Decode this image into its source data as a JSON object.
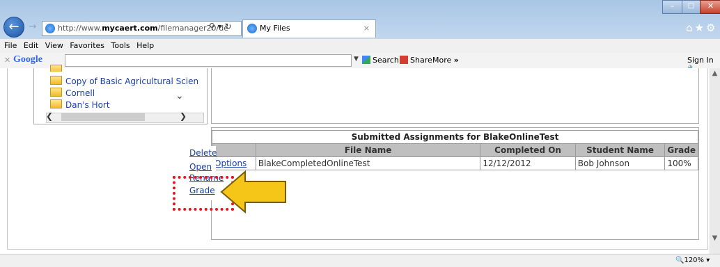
{
  "browser": {
    "address_url": "http://www.mycaert.com/filemanager20/de",
    "address_url_bold": "mycaert.com",
    "tab_title": "My Files",
    "tab_close": "×",
    "menu": [
      "File",
      "Edit",
      "View",
      "Favorites",
      "Tools",
      "Help"
    ],
    "google_toolbar": {
      "logo": "Google",
      "search_label": "Search",
      "share_label": "Share",
      "more_label": "More",
      "more_glyph": "»",
      "signin_label": "Sign In"
    },
    "zoom_label": "120%"
  },
  "folder_tree": {
    "items": [
      "Copy of Basic Agricultural Scien",
      "Cornell",
      "Dan's Hort"
    ]
  },
  "assignments": {
    "caption": "Submitted Assignments for BlakeOnlineTest",
    "columns": [
      "",
      "File Name",
      "Completed On",
      "Student Name",
      "Grade"
    ],
    "rows": [
      {
        "options": "Options",
        "file_name": "BlakeCompletedOnlineTest",
        "completed_on": "12/12/2012",
        "student_name": "Bob Johnson",
        "grade": "100%"
      }
    ]
  },
  "context_menu": {
    "items": [
      "Delete",
      "Open",
      "Rename",
      "Grade"
    ]
  },
  "annotation": {
    "highlight_color": "#e0181c",
    "arrow_color": "#f5c518"
  }
}
